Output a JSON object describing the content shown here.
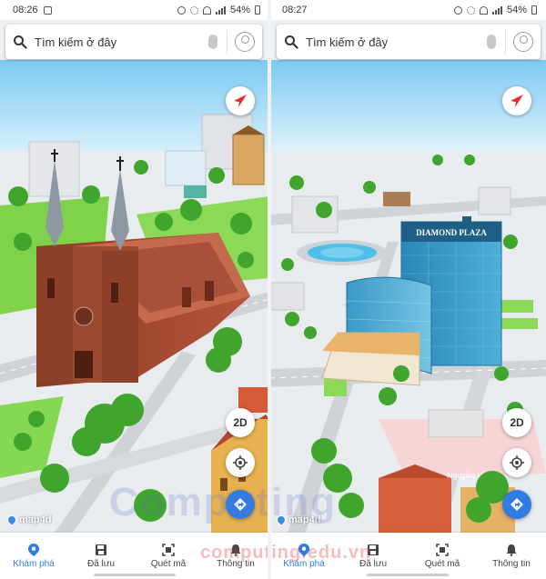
{
  "screens": [
    {
      "status": {
        "time": "08:26",
        "battery": "54%"
      },
      "search": {
        "placeholder": "Tìm kiếm ở đây"
      },
      "map": {
        "mode_button": "2D",
        "logo": "map4d"
      }
    },
    {
      "status": {
        "time": "08:27",
        "battery": "54%"
      },
      "search": {
        "placeholder": "Tìm kiếm ở đây"
      },
      "map": {
        "mode_button": "2D",
        "logo": "map4d",
        "building_label": "DIAMOND PLAZA",
        "street_label": "Nguyễn Văn"
      }
    }
  ],
  "nav": {
    "items": [
      {
        "label": "Khám phá",
        "icon": "location-pin-icon",
        "active": true
      },
      {
        "label": "Đã lưu",
        "icon": "save-icon",
        "active": false
      },
      {
        "label": "Quét mã",
        "icon": "qr-scan-icon",
        "active": false
      },
      {
        "label": "Thông tin",
        "icon": "bell-icon",
        "active": false
      }
    ]
  },
  "watermark": {
    "big": "Computing",
    "small": "computing.edu.vn"
  },
  "colors": {
    "accent": "#2f7de1",
    "compass": "#e8262b",
    "grass": "#7fd24a",
    "sky": "#8fd3f7"
  }
}
